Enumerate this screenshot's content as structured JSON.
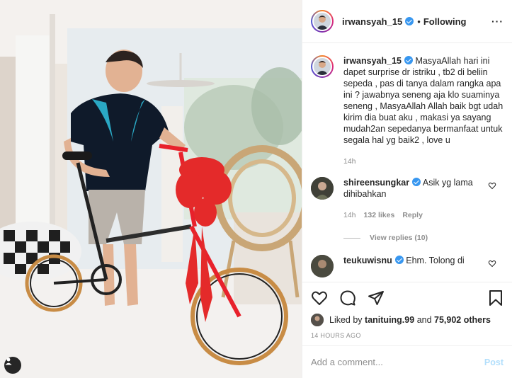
{
  "post": {
    "username": "irwansyah_15",
    "verified": true,
    "separator": "•",
    "follow_state": "Following",
    "more_icon": "more-horizontal-icon"
  },
  "caption": {
    "username": "irwansyah_15",
    "text": "MasyaAllah hari ini dapet surprise dr istriku , tb2 di beliin sepeda , pas di tanya dalam rangka apa ini ? jawabnya seneng aja klo suaminya seneng , MasyaAllah Allah baik bgt udah kirim dia buat aku , makasi ya sayang mudah2an sepedanya bermanfaat untuk segala hal yg baik2 , love u",
    "time": "14h"
  },
  "comments": [
    {
      "username": "shireensungkar",
      "verified": true,
      "text": "Asik yg lama dihibahkan",
      "time": "14h",
      "likes": "132 likes",
      "reply_label": "Reply",
      "view_replies": "View replies (10)"
    },
    {
      "username": "teukuwisnu",
      "verified": true,
      "text": "Ehm. Tolong di"
    }
  ],
  "actions": {
    "like_icon": "heart-icon",
    "comment_icon": "comment-icon",
    "share_icon": "paper-plane-icon",
    "save_icon": "bookmark-icon"
  },
  "likes": {
    "prefix": "Liked by",
    "user": "tanituing.99",
    "connector": "and",
    "others": "75,902 others"
  },
  "timestamp": "14 HOURS AGO",
  "add_comment": {
    "placeholder": "Add a comment...",
    "post_label": "Post"
  },
  "colors": {
    "verified": "#3897f0",
    "post_button_disabled": "#b2dffc",
    "muted_text": "#8e8e8e",
    "bike_frame": "#e8212b",
    "ribbon": "#e42a2a"
  }
}
